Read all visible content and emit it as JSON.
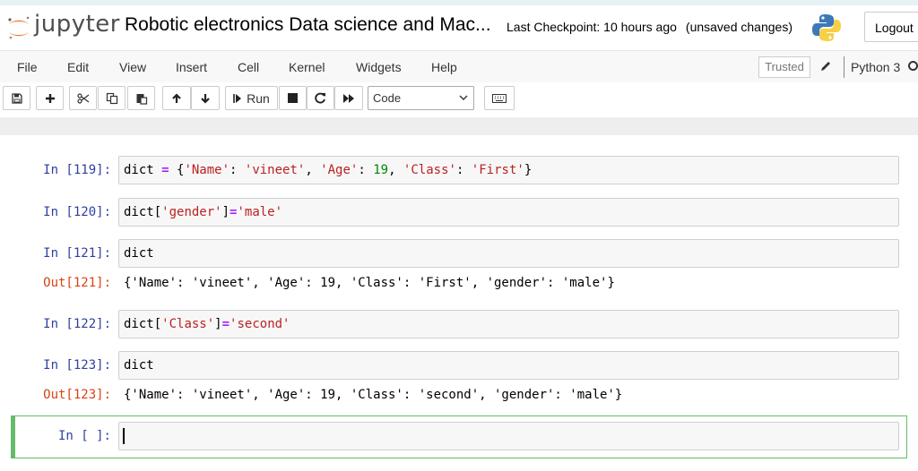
{
  "header": {
    "logo_text": "jupyter",
    "notebook_title": "Robotic electronics Data science and Mac...",
    "checkpoint": "Last Checkpoint: 10 hours ago",
    "unsaved": "(unsaved changes)",
    "logout_label": "Logout"
  },
  "menu": {
    "items": [
      "File",
      "Edit",
      "View",
      "Insert",
      "Cell",
      "Kernel",
      "Widgets",
      "Help"
    ],
    "trusted_label": "Trusted",
    "kernel_name": "Python 3"
  },
  "toolbar": {
    "run_label": "Run",
    "cell_type": "Code",
    "icons": [
      "save-icon",
      "plus-icon",
      "cut-icon",
      "copy-icon",
      "paste-icon",
      "arrow-up-icon",
      "arrow-down-icon",
      "run-icon",
      "stop-icon",
      "restart-icon",
      "fast-forward-icon",
      "keyboard-icon"
    ]
  },
  "cells": [
    {
      "prompt": "In [119]:",
      "tokens": [
        {
          "t": "dict",
          "c": "var"
        },
        {
          "t": " = ",
          "c": "op"
        },
        {
          "t": "{",
          "c": "p"
        },
        {
          "t": "'Name'",
          "c": "str"
        },
        {
          "t": ": ",
          "c": "p"
        },
        {
          "t": "'vineet'",
          "c": "str"
        },
        {
          "t": ", ",
          "c": "p"
        },
        {
          "t": "'Age'",
          "c": "str"
        },
        {
          "t": ": ",
          "c": "p"
        },
        {
          "t": "19",
          "c": "num"
        },
        {
          "t": ", ",
          "c": "p"
        },
        {
          "t": "'Class'",
          "c": "str"
        },
        {
          "t": ": ",
          "c": "p"
        },
        {
          "t": "'First'",
          "c": "str"
        },
        {
          "t": "}",
          "c": "p"
        }
      ]
    },
    {
      "prompt": "In [120]:",
      "tokens": [
        {
          "t": "dict",
          "c": "var"
        },
        {
          "t": "[",
          "c": "p"
        },
        {
          "t": "'gender'",
          "c": "str"
        },
        {
          "t": "]",
          "c": "p"
        },
        {
          "t": "=",
          "c": "op"
        },
        {
          "t": "'male'",
          "c": "str"
        }
      ]
    },
    {
      "prompt": "In [121]:",
      "tokens": [
        {
          "t": "dict",
          "c": "var"
        }
      ],
      "out_prompt": "Out[121]:",
      "output": "{'Name': 'vineet', 'Age': 19, 'Class': 'First', 'gender': 'male'}"
    },
    {
      "prompt": "In [122]:",
      "tokens": [
        {
          "t": "dict",
          "c": "var"
        },
        {
          "t": "[",
          "c": "p"
        },
        {
          "t": "'Class'",
          "c": "str"
        },
        {
          "t": "]",
          "c": "p"
        },
        {
          "t": "=",
          "c": "op"
        },
        {
          "t": "'second'",
          "c": "str"
        }
      ]
    },
    {
      "prompt": "In [123]:",
      "tokens": [
        {
          "t": "dict",
          "c": "var"
        }
      ],
      "out_prompt": "Out[123]:",
      "output": "{'Name': 'vineet', 'Age': 19, 'Class': 'second', 'gender': 'male'}"
    },
    {
      "prompt": "In [ ]:",
      "tokens": []
    }
  ],
  "colors": {
    "in_prompt": "#303f9f",
    "out_prompt": "#d84315",
    "active_cell": "#66bb6a"
  }
}
